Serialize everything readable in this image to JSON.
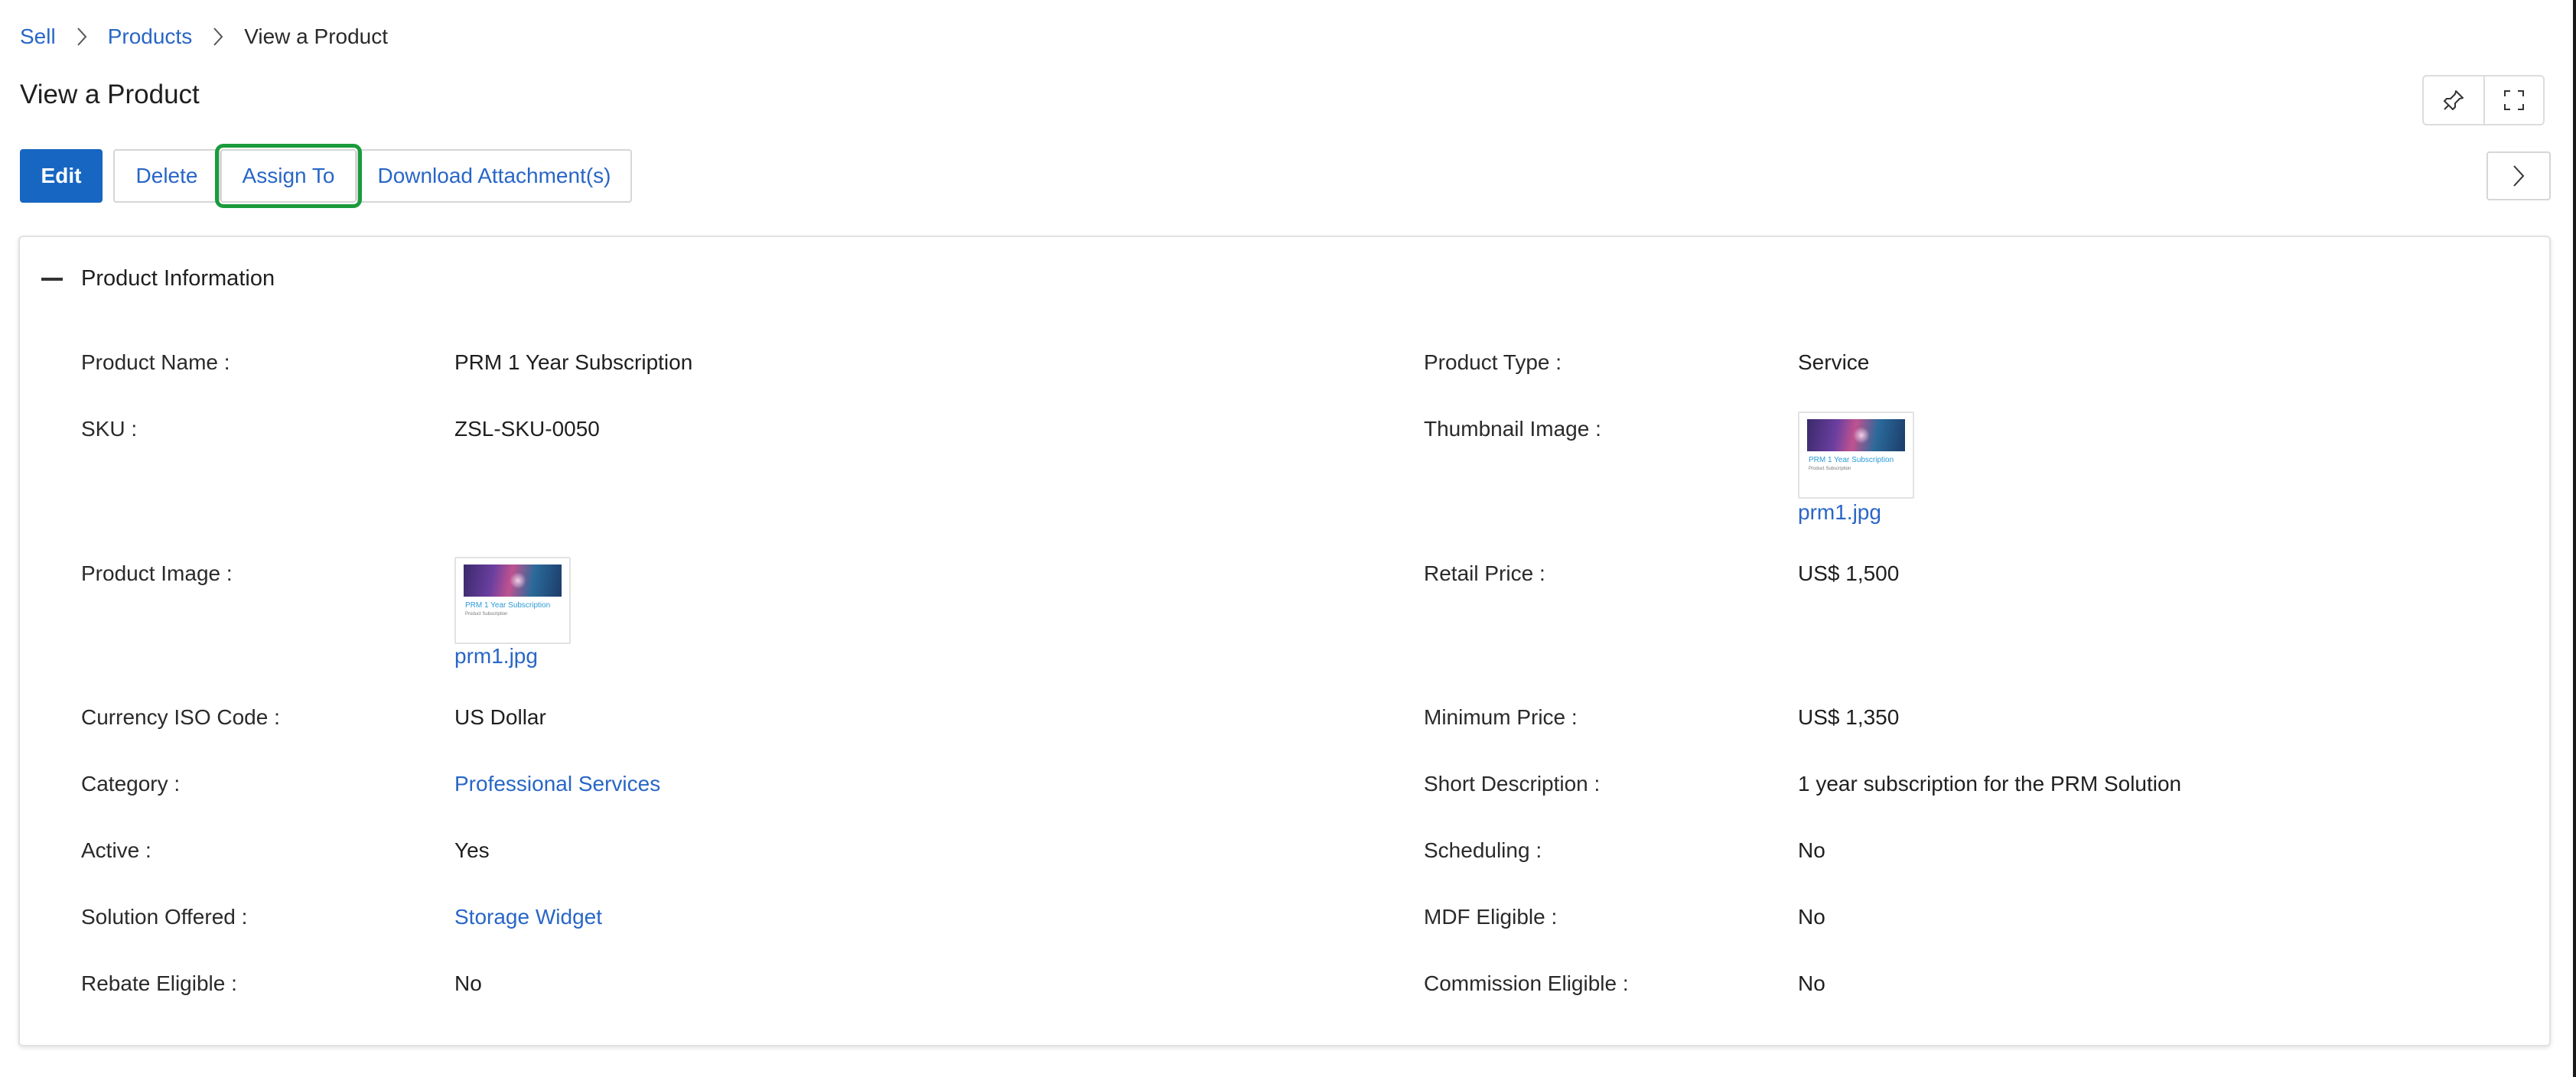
{
  "breadcrumb": {
    "items": [
      "Sell",
      "Products"
    ],
    "current": "View a Product"
  },
  "page": {
    "title": "View a Product"
  },
  "actions": {
    "edit": "Edit",
    "delete": "Delete",
    "assign": "Assign To",
    "download": "Download Attachment(s)"
  },
  "section": {
    "title": "Product Information"
  },
  "fields": {
    "product_name": {
      "label": "Product Name :",
      "value": "PRM 1 Year Subscription"
    },
    "product_type": {
      "label": "Product Type :",
      "value": "Service"
    },
    "sku": {
      "label": "SKU :",
      "value": "ZSL-SKU-0050"
    },
    "thumbnail_image": {
      "label": "Thumbnail Image :",
      "value": "prm1.jpg"
    },
    "product_image": {
      "label": "Product Image :",
      "value": "prm1.jpg"
    },
    "retail_price": {
      "label": "Retail Price :",
      "value": "US$ 1,500"
    },
    "currency": {
      "label": "Currency ISO Code :",
      "value": "US Dollar"
    },
    "minimum_price": {
      "label": "Minimum Price :",
      "value": "US$ 1,350"
    },
    "category": {
      "label": "Category :",
      "value": "Professional Services"
    },
    "short_description": {
      "label": "Short Description :",
      "value": "1 year subscription for the PRM Solution"
    },
    "active": {
      "label": "Active :",
      "value": "Yes"
    },
    "scheduling": {
      "label": "Scheduling :",
      "value": "No"
    },
    "solution_offered": {
      "label": "Solution Offered :",
      "value": "Storage Widget"
    },
    "mdf_eligible": {
      "label": "MDF Eligible :",
      "value": "No"
    },
    "rebate_eligible": {
      "label": "Rebate Eligible :",
      "value": "No"
    },
    "commission_eligible": {
      "label": "Commission Eligible :",
      "value": "No"
    }
  },
  "thumbnail_preview": {
    "title": "PRM 1 Year Subscription",
    "subtitle": "Product Subscription"
  },
  "icons": {
    "pin": "pin-icon",
    "fullscreen": "fullscreen-icon",
    "next": "chevron-right-icon",
    "collapse": "minus-icon"
  },
  "colors": {
    "primary": "#1766c2",
    "link": "#2866c7",
    "highlight": "#1a9b3b"
  }
}
